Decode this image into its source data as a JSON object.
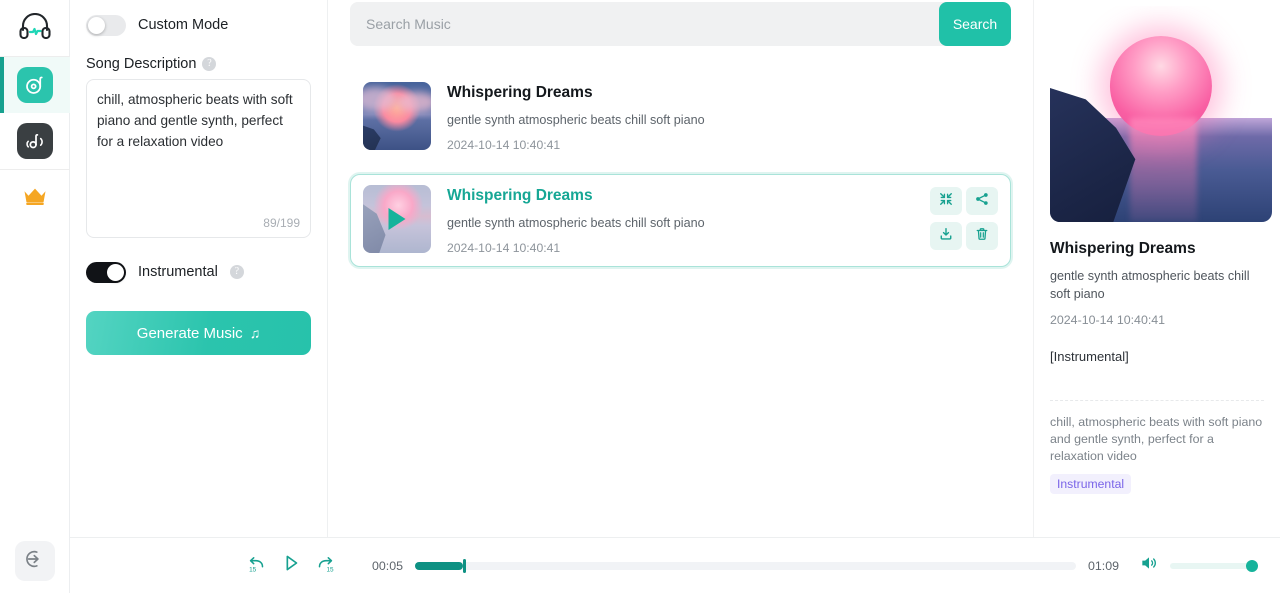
{
  "colors": {
    "accent": "#20c1a8",
    "accent_dark": "#0e9183",
    "active_rail": "#17a18f",
    "tag_text": "#7a64e8",
    "tag_bg": "#f2f0fd"
  },
  "rail": {
    "logo_icon": "headphones-icon",
    "items": [
      {
        "icon": "music-disc-icon",
        "name": "sidebar-item-generate",
        "active": true
      },
      {
        "icon": "sound-wave-note-icon",
        "name": "sidebar-item-library",
        "active": false
      }
    ],
    "crown_icon": "crown-icon",
    "login_icon": "login-arrow-icon"
  },
  "panel": {
    "custom_mode": {
      "label": "Custom Mode",
      "on": false
    },
    "song_description": {
      "label": "Song Description",
      "help_icon": "help-icon",
      "value": "chill, atmospheric beats with soft piano and gentle synth, perfect for a relaxation video",
      "counter": "89/199"
    },
    "instrumental": {
      "label": "Instrumental",
      "on": true,
      "help_icon": "help-icon"
    },
    "generate_button": {
      "label": "Generate Music",
      "icon": "music-note-icon"
    }
  },
  "search": {
    "placeholder": "Search Music",
    "value": "",
    "button_label": "Search"
  },
  "tracks": [
    {
      "title": "Whispering Dreams",
      "description": "gentle synth atmospheric beats chill soft piano",
      "date": "2024-10-14 10:40:41",
      "selected": false,
      "playing": false
    },
    {
      "title": "Whispering Dreams",
      "description": "gentle synth atmospheric beats chill soft piano",
      "date": "2024-10-14 10:40:41",
      "selected": true,
      "playing": true,
      "actions": [
        {
          "name": "expand-button",
          "icon": "shrink-arrows-icon"
        },
        {
          "name": "share-button",
          "icon": "share-icon"
        },
        {
          "name": "download-button",
          "icon": "download-icon"
        },
        {
          "name": "delete-button",
          "icon": "trash-icon"
        }
      ]
    }
  ],
  "detail": {
    "cover_alt": "sunset-seascape-cover",
    "title": "Whispering Dreams",
    "description": "gentle synth atmospheric beats chill soft piano",
    "date": "2024-10-14 10:40:41",
    "lyrics": "[Instrumental]",
    "prompt": "chill, atmospheric beats with soft piano and gentle synth, perfect for a relaxation video",
    "tag": "Instrumental"
  },
  "player": {
    "rewind_label": "15",
    "forward_label": "15",
    "rewind_icon": "rewind-15-icon",
    "play_icon": "play-icon",
    "forward_icon": "forward-15-icon",
    "current_time": "00:05",
    "total_time": "01:09",
    "progress_percent": 7.3,
    "volume_icon": "volume-icon",
    "volume_percent": 100
  }
}
